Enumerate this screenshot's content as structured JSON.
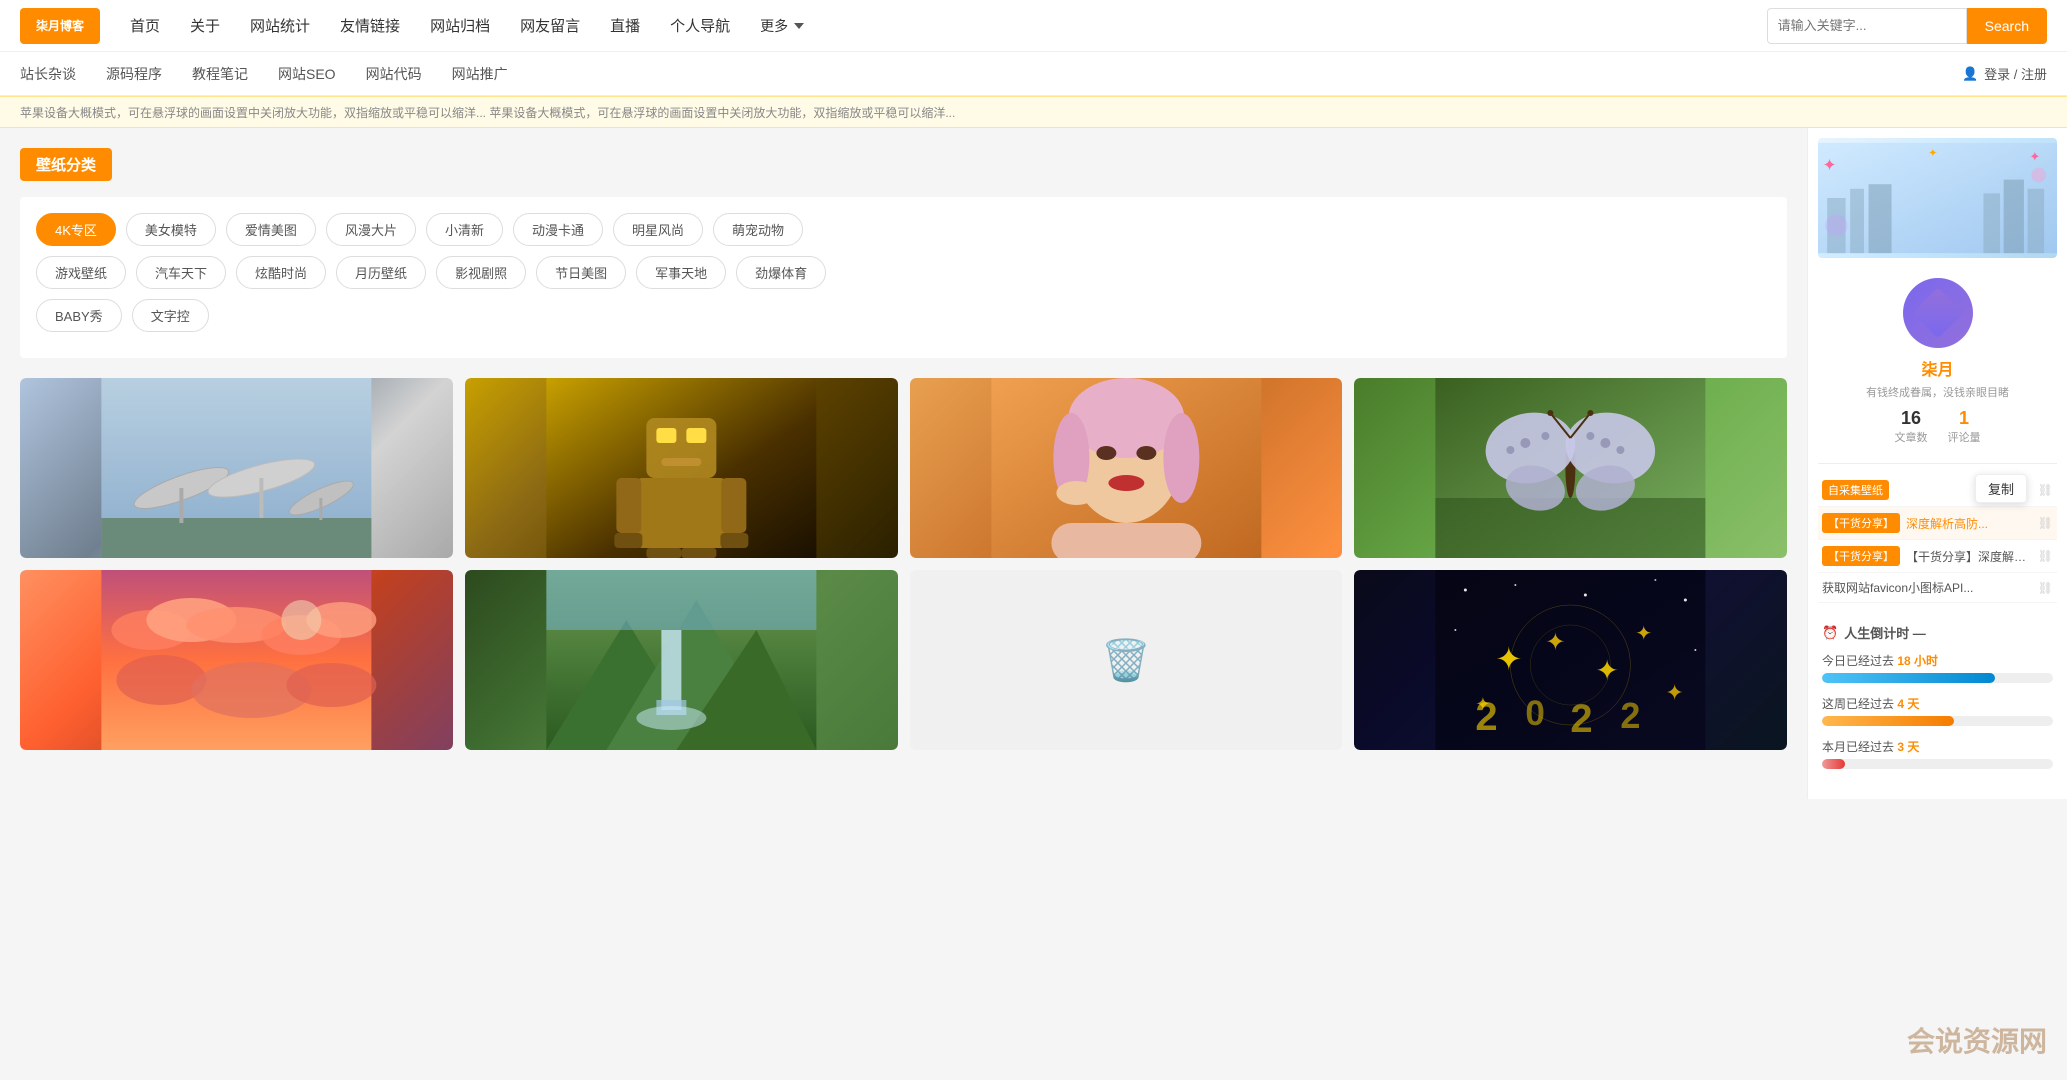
{
  "header": {
    "logo_text": "柒月博客",
    "nav_items": [
      "首页",
      "关于",
      "网站统计",
      "友情链接",
      "网站归档",
      "网友留言",
      "直播",
      "个人导航",
      "更多"
    ],
    "search_placeholder": "请输入关键字...",
    "search_btn": "Search"
  },
  "subnav": {
    "items": [
      "站长杂谈",
      "源码程序",
      "教程笔记",
      "网站SEO",
      "网站代码",
      "网站推广"
    ],
    "login_text": "登录 / 注册"
  },
  "ticker": {
    "text": "苹果设备大概模式，可在悬浮球的画面设置中关闭放大功能，双指缩放或平稳可以缩洋... 苹果设备大概模式，可在悬浮球的画面设置中关闭放大功能，双指缩放或平稳可以缩洋..."
  },
  "wallpaper_section": {
    "title": "壁纸分类",
    "categories": [
      {
        "label": "4K专区",
        "active": true
      },
      {
        "label": "美女模特",
        "active": false
      },
      {
        "label": "爱情美图",
        "active": false
      },
      {
        "label": "风漫大片",
        "active": false
      },
      {
        "label": "小清新",
        "active": false
      },
      {
        "label": "动漫卡通",
        "active": false
      },
      {
        "label": "明星风尚",
        "active": false
      },
      {
        "label": "萌宠动物",
        "active": false
      },
      {
        "label": "游戏壁纸",
        "active": false
      },
      {
        "label": "汽车天下",
        "active": false
      },
      {
        "label": "炫酷时尚",
        "active": false
      },
      {
        "label": "月历壁纸",
        "active": false
      },
      {
        "label": "影视剧照",
        "active": false
      },
      {
        "label": "节日美图",
        "active": false
      },
      {
        "label": "军事天地",
        "active": false
      },
      {
        "label": "劲爆体育",
        "active": false
      },
      {
        "label": "BABY秀",
        "active": false
      },
      {
        "label": "文字控",
        "active": false
      }
    ]
  },
  "images": [
    {
      "id": 1,
      "type": "satellite",
      "label": "卫星天线"
    },
    {
      "id": 2,
      "type": "robot",
      "label": "机器人"
    },
    {
      "id": 3,
      "type": "woman",
      "label": "美女"
    },
    {
      "id": 4,
      "type": "butterfly",
      "label": "蝴蝶"
    },
    {
      "id": 5,
      "type": "sunset",
      "label": "夕阳云彩"
    },
    {
      "id": 6,
      "type": "waterfall",
      "label": "山间瀑布"
    },
    {
      "id": 7,
      "type": "empty",
      "label": ""
    },
    {
      "id": 8,
      "type": "stars",
      "label": "星空"
    }
  ],
  "sidebar": {
    "user": {
      "name": "柒月",
      "motto": "有钱终成眷属，没钱亲眼目睹",
      "article_count": "16",
      "article_label": "文章数",
      "comment_count": "1",
      "comment_label": "评论量"
    },
    "links": [
      {
        "tag": "自采集壁纸",
        "tag_type": "orange",
        "text": "",
        "has_copy": true
      },
      {
        "tag": "【干货分享】",
        "tag_type": "orange",
        "text": "深度解析高防...",
        "has_arrow": true
      },
      {
        "tag": "【干货分享】",
        "tag_type": "orange",
        "text": "【干货分享】深度解析高防服...",
        "has_arrow": true
      },
      {
        "tag": "",
        "tag_type": "",
        "text": "获取网站favicon小图标API...",
        "has_arrow": true
      }
    ],
    "countdown": {
      "header": "⏰ 人生倒计时 —",
      "today_label": "今日已经过去",
      "today_value": "18",
      "today_unit": "小时",
      "today_percent": 75,
      "week_label": "这周已经过去",
      "week_value": "4",
      "week_unit": "天",
      "week_percent": 57,
      "month_label": "本月已经过去",
      "month_value": "3",
      "month_unit": "天",
      "month_percent": 10
    }
  },
  "tooltip": {
    "text": "复制"
  },
  "bottom_watermark": "会说资源网"
}
